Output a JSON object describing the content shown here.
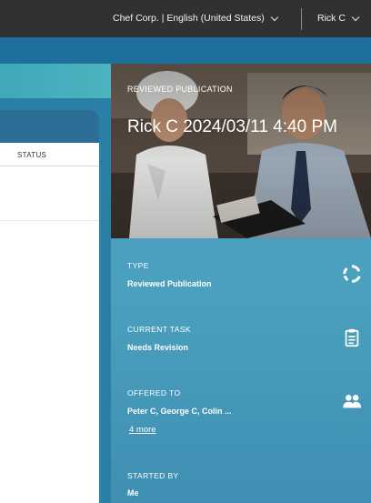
{
  "topbar": {
    "org_language": "Chef Corp. | English (United States)",
    "user": "Rick C"
  },
  "background_table": {
    "status_header": "STATUS"
  },
  "detail": {
    "kicker": "REVIEWED PUBLICATION",
    "title": "Rick C 2024/03/11 4:40 PM",
    "items": [
      {
        "label": "TYPE",
        "value": "Reviewed Publication",
        "icon": "sync-icon"
      },
      {
        "label": "CURRENT TASK",
        "value": "Needs Revision",
        "icon": "clipboard-icon"
      },
      {
        "label": "OFFERED TO",
        "value": "Peter C, George C, Colin ...",
        "icon": "people-icon",
        "more": "4 more"
      },
      {
        "label": "STARTED BY",
        "value": "Me"
      }
    ]
  },
  "colors": {
    "topbar": "#2f3133",
    "blue_band": "#1f6f9c",
    "panel": "#4aa5c0",
    "accent_teal": "#3fa9b9"
  }
}
